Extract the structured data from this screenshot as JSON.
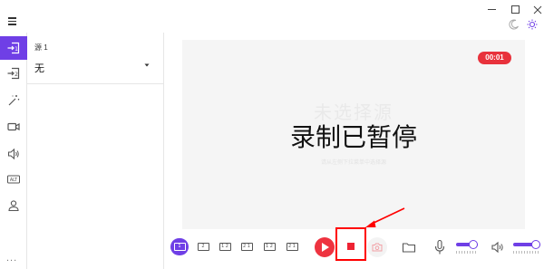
{
  "source_panel": {
    "title": "源 1",
    "selected_source": "无"
  },
  "preview": {
    "status_text": "录制已暂停",
    "faint_title": "未选择源",
    "faint_hint": "请从左侧下拉菜单中选择源",
    "timer": "00:01"
  },
  "layouts": [
    {
      "label": "1",
      "active": true
    },
    {
      "label": "2",
      "active": false
    },
    {
      "label": "1 2",
      "active": false
    },
    {
      "label": "2 1",
      "active": false
    },
    {
      "label": "1 2",
      "active": false
    },
    {
      "label": "2 1",
      "active": false
    }
  ],
  "nav": {
    "items": [
      {
        "icon": "source-1-icon",
        "label": "1",
        "active": true
      },
      {
        "icon": "source-2-icon",
        "label": "2",
        "active": false
      },
      {
        "icon": "magic-wand-icon",
        "active": false
      },
      {
        "icon": "camera-icon",
        "active": false
      },
      {
        "icon": "speaker-icon",
        "active": false
      },
      {
        "icon": "alt-icon",
        "label": "ALT",
        "active": false
      },
      {
        "icon": "person-icon",
        "active": false
      }
    ],
    "more": "..."
  },
  "audio": {
    "mic_level": 0.9,
    "speaker_level": 0.9
  },
  "colors": {
    "accent": "#6f3fe6",
    "record_red": "#ee3340",
    "annotation_red": "#ff0000"
  }
}
